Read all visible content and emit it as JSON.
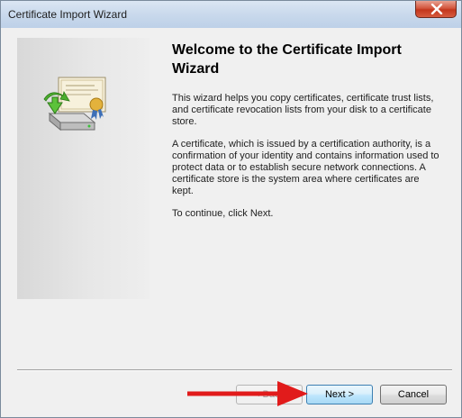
{
  "window": {
    "title": "Certificate Import Wizard"
  },
  "main": {
    "heading": "Welcome to the Certificate Import Wizard",
    "paragraphs": [
      "This wizard helps you copy certificates, certificate trust lists, and certificate revocation lists from your disk to a certificate store.",
      "A certificate, which is issued by a certification authority, is a confirmation of your identity and contains information used to protect data or to establish secure network connections. A certificate store is the system area where certificates are kept.",
      "To continue, click Next."
    ]
  },
  "buttons": {
    "back_label": "< Back",
    "next_label": "Next >",
    "cancel_label": "Cancel"
  },
  "icons": {
    "close": "close-icon",
    "wizard_graphic": "certificate-import-icon",
    "annotation": "red-arrow-icon"
  },
  "colors": {
    "close_button": "#c3361c",
    "annotation_arrow": "#e11b1b",
    "default_button_border": "#3c7fb1"
  }
}
